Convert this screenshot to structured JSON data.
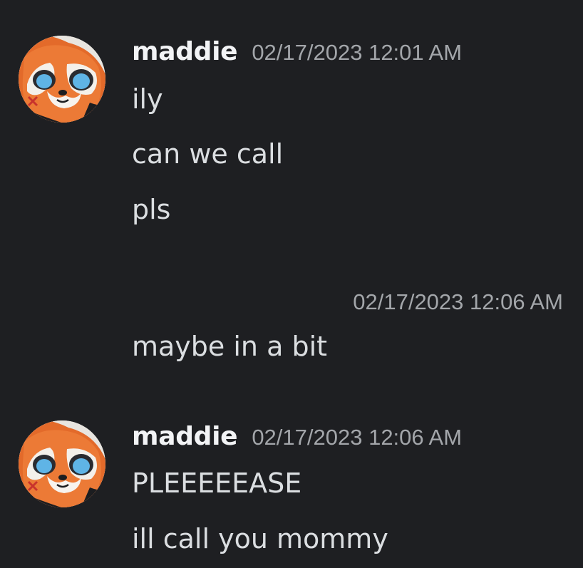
{
  "groups": [
    {
      "username": "maddie",
      "timestamp": "02/17/2023 12:01 AM",
      "avatar_icon": "red-panda-avatar-icon",
      "messages": [
        "ily",
        "can we call",
        "pls"
      ]
    },
    {
      "timestamp": "02/17/2023 12:06 AM",
      "messages": [
        "maybe in a bit"
      ]
    },
    {
      "username": "maddie",
      "timestamp": "02/17/2023 12:06 AM",
      "avatar_icon": "red-panda-avatar-icon",
      "messages": [
        "PLEEEEEASE",
        "ill call you mommy"
      ]
    }
  ],
  "colors": {
    "background": "#1e1f22",
    "username": "#f2f3f5",
    "timestamp": "#a3a6aa",
    "message": "#dbdee1"
  }
}
